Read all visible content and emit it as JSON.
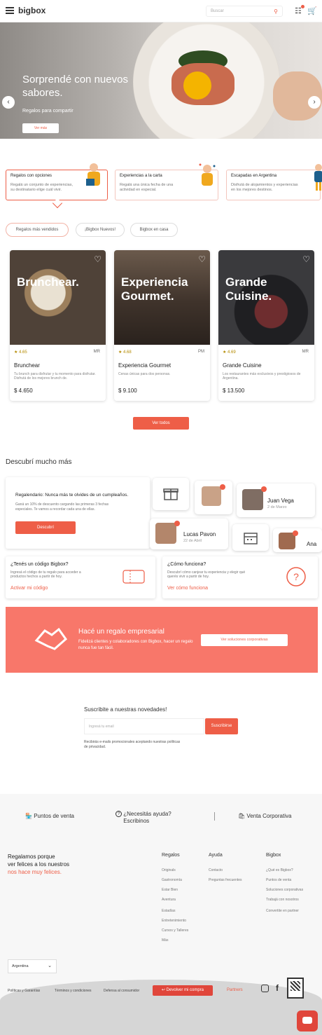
{
  "header": {
    "logo": "bigbox",
    "search_placeholder": "Buscar"
  },
  "hero": {
    "title": "Sorprendé con nuevos sabores.",
    "subtitle": "Regalos para compartir",
    "button": "Ver más"
  },
  "categories": [
    {
      "title": "Regalos con opciones",
      "desc": "Regalá un conjunto de experiencias, su destinatario elige cuál vivir."
    },
    {
      "title": "Experiencias a la carta",
      "desc": "Regalá una única fecha de una actividad en especial."
    },
    {
      "title": "Escapadas en Argentina",
      "desc": "Disfrutá de alojamientos y experiencias en los mejores destinos."
    }
  ],
  "tabs": [
    "Regalos más vendidos",
    "¡Bigbox Nuevos!",
    "Bigbox en casa"
  ],
  "products": [
    {
      "overlay": "Brunchear.",
      "rating": "4.65",
      "location": "MR",
      "name": "Brunchear",
      "desc": "Tu brunch para disfrutar y tu momento para disfrutar. Disfrutá de los mejores brunch de.",
      "price": "$ 4.650"
    },
    {
      "overlay": "Experiencia Gourmet.",
      "rating": "4.68",
      "location": "PM",
      "name": "Experiencia Gourmet",
      "desc": "Cenas únicas para dos personas.",
      "price": "$ 9.100"
    },
    {
      "overlay": "Grande Cuisine.",
      "rating": "4.69",
      "location": "MR",
      "name": "Grande Cuisine",
      "desc": "Los restaurantes más exclusivos y prestigiosos de Argentina.",
      "price": "$ 13.500"
    }
  ],
  "see_all": "Ver todos",
  "discover": {
    "title": "Descubrí mucho más",
    "promo_title": "Regalendario: Nunca más te olvides de un cumpleaños.",
    "promo_desc": "Ganá un 10% de descuento cargando las primeras 3 fechas especiales. Te vamos a recordar cada una de ellas.",
    "promo_button": "Descubrí",
    "person1_name": "Juan Vega",
    "person1_date": "2 de Marzo",
    "person2_name": "Lucas Pavon",
    "person2_date": "22 de Abril",
    "person3_name": "Ana"
  },
  "info": [
    {
      "title": "¿Tenés un código Bigbox?",
      "desc": "Ingresá el código de tu regalo para acceder a productos hechos a partir de hoy.",
      "link": "Activar mi código"
    },
    {
      "title": "¿Cómo funciona?",
      "desc": "Descubrí cómo canjear tu experiencia y elegir qué querés vivir a partir de hoy.",
      "link": "Ver cómo funciona"
    }
  ],
  "corporate": {
    "title": "Hacé un regalo empresarial",
    "desc": "Fidelizá clientes y colaboradores con Bigbox, hacer un regalo nunca fue tan fácil.",
    "button": "Ver soluciones corporativas"
  },
  "newsletter": {
    "title": "Suscribite a nuestras novedades!",
    "placeholder": "Ingresá tu email",
    "button": "Suscribirse",
    "note": "Recibirás e-mails promocionales aceptando nuestras políticas de privacidad."
  },
  "help": {
    "points": "Puntos de venta",
    "need_help": "¿Necesitás ayuda?",
    "write_us": "Escribinos",
    "corporate_sale": "Venta Corporativa"
  },
  "footer": {
    "tagline1": "Regalamos porque",
    "tagline2": "ver felices a los nuestros",
    "tagline3": "nos hace muy felices.",
    "col1_title": "Regalos",
    "col1": [
      "Originals",
      "Gastronomía",
      "Estar Bien",
      "Aventura",
      "Estadías",
      "Entretenimiento",
      "Cursos y Talleres",
      "Más"
    ],
    "col2_title": "Ayuda",
    "col2": [
      "Contacto",
      "Preguntas frecuentes"
    ],
    "col3_title": "Bigbox",
    "col3": [
      "¿Qué es Bigbox?",
      "Puntos de venta",
      "Soluciones corporativas",
      "Trabajá con nosotros",
      "Convertite en partner"
    ],
    "country": "Argentina",
    "legal1": "Políticas y Garantías",
    "legal2": "Términos y condiciones",
    "legal3": "Defensa al consumidor",
    "return_button": "Devolver mi compra",
    "partners": "Partners"
  },
  "colors": {
    "accent": "#ee5e47",
    "banner": "#f8776a"
  }
}
